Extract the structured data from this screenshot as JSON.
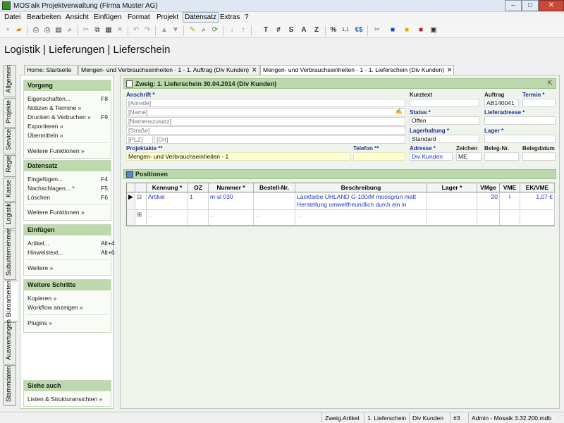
{
  "app": {
    "title": "MOS'aik Projektverwaltung (Firma Muster AG)"
  },
  "menu": [
    "Datei",
    "Bearbeiten",
    "Ansicht",
    "Einfügen",
    "Format",
    "Projekt",
    "Datensatz",
    "Extras",
    "?"
  ],
  "page_title": "Logistik | Lieferungen | Lieferschein",
  "vertical_tabs": [
    "Allgemein",
    "Projekte",
    "Service",
    "Regie",
    "Kasse",
    "Logistik",
    "Subunternehmer",
    "Büroarbeiten",
    "Auswertungen",
    "Stammdaten"
  ],
  "doc_tabs": [
    {
      "label": "Home: Startseite"
    },
    {
      "label": "Mengen- und Verbrauchseinheiten - 1 - 1. Auftrag (Div Kunden)"
    },
    {
      "label": "Mengen- und Verbrauchseinheiten - 1 - 1. Lieferschein (Div Kunden)"
    }
  ],
  "left": {
    "vorgang": {
      "title": "Vorgang",
      "items": [
        {
          "label": "Eigenschaften...",
          "key": "F8"
        },
        {
          "label": "Notizen & Termine »",
          "key": ""
        },
        {
          "label": "Drucken & Verbuchen »",
          "key": "F9"
        },
        {
          "label": "Exportieren »",
          "key": ""
        },
        {
          "label": "Übermitteln »",
          "key": ""
        }
      ],
      "more": "Weitere Funktionen »"
    },
    "datensatz": {
      "title": "Datensatz",
      "items": [
        {
          "label": "Eingefügen...",
          "key": "F4"
        },
        {
          "label": "Nachschlagen... *",
          "key": "F5"
        },
        {
          "label": "Löschen",
          "key": "F6"
        }
      ],
      "more": "Weitere Funktionen »"
    },
    "einfuegen": {
      "title": "Einfügen",
      "items": [
        {
          "label": "Artikel...",
          "key": "Alt+4"
        },
        {
          "label": "Hinweistext...",
          "key": "Alt+6"
        }
      ],
      "more": "Weitere »"
    },
    "schritte": {
      "title": "Weitere Schritte",
      "items": [
        {
          "label": "Kopieren »"
        },
        {
          "label": "Workflow anzeigen »"
        }
      ],
      "more": "Plugins »"
    },
    "siehe": {
      "title": "Siehe auch",
      "items": [
        {
          "label": "Listen & Strukturansichten »"
        }
      ]
    }
  },
  "header": {
    "title": "Zweig: 1. Lieferschein 30.04.2014 (Div Kunden)",
    "anschrift_label": "Anschrift *",
    "anrede": "[Anrede]",
    "name": "[Name]",
    "namenszusatz": "[Namenszusatz]",
    "strasse": "[Straße]",
    "plz": "[PLZ]",
    "ort": "[Ort]",
    "kurztext_label": "Kurztext",
    "kurztext": "",
    "auftrag_label": "Auftrag",
    "auftrag": "AB140041",
    "termin_label": "Termin *",
    "termin": "",
    "status_label": "Status *",
    "status": "Offen",
    "lieferadresse_label": "Lieferadresse *",
    "lieferadresse": "",
    "lagerhaltung_label": "Lagerhaltung *",
    "lagerhaltung": "Standard",
    "lager_label": "Lager *",
    "lager": "",
    "projektakte_label": "Projektakte **",
    "projektakte": "Mengen- und Verbrauchseinheiten - 1",
    "telefon_label": "Telefon **",
    "telefon": "",
    "adresse_label": "Adresse *",
    "adresse": "Div Kunden",
    "zeichen_label": "Zeichen",
    "zeichen": "ME",
    "belegnr_label": "Beleg-Nr.",
    "belegnr": "",
    "belegdatum_label": "Belegdatum",
    "belegdatum": ""
  },
  "positions": {
    "title": "Positionen",
    "columns": [
      "Kennung *",
      "OZ",
      "Nummer *",
      "Bestell-Nr.",
      "Beschreibung",
      "Lager *",
      "VMge",
      "VME",
      "EK/VME"
    ],
    "rows": [
      {
        "kennung": "Artikel",
        "oz": "1",
        "nummer": "m-sl 030",
        "bestell": "",
        "beschreibung": "Lackfarbe UHLAND G-100/M moosgrün matt Herstellung umweltfreundlich durch ein in",
        "lager": "",
        "vmge": "20",
        "vme": "l",
        "ek": "1,07 €"
      },
      {
        "kennung": "...",
        "oz": "",
        "nummer": "...",
        "bestell": "...",
        "beschreibung": "...",
        "lager": "",
        "vmge": "",
        "vme": "",
        "ek": ""
      }
    ]
  },
  "statusbar": [
    "Zweig.Artikel",
    "1. Lieferschein",
    "Div Kunden",
    "#3",
    "Admin - Mosaik 3.32.200.mdb"
  ]
}
